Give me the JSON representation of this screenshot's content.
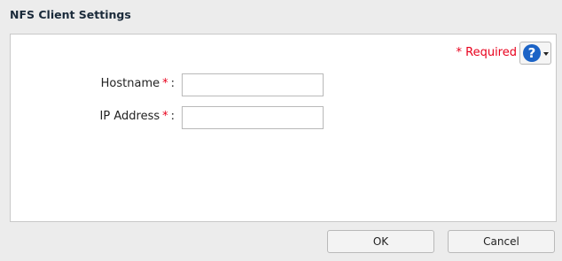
{
  "dialog": {
    "title": "NFS Client Settings",
    "required_note": "* Required",
    "help_icon": "question-mark-icon",
    "fields": [
      {
        "label": "Hostname",
        "required_mark": "*",
        "colon": ":",
        "value": "",
        "placeholder": ""
      },
      {
        "label": "IP Address",
        "required_mark": "*",
        "colon": ":",
        "value": "",
        "placeholder": ""
      }
    ],
    "buttons": {
      "ok": "OK",
      "cancel": "Cancel"
    },
    "help_glyph": "?",
    "accent_color": "#e8001c",
    "help_color": "#1b63c6"
  }
}
